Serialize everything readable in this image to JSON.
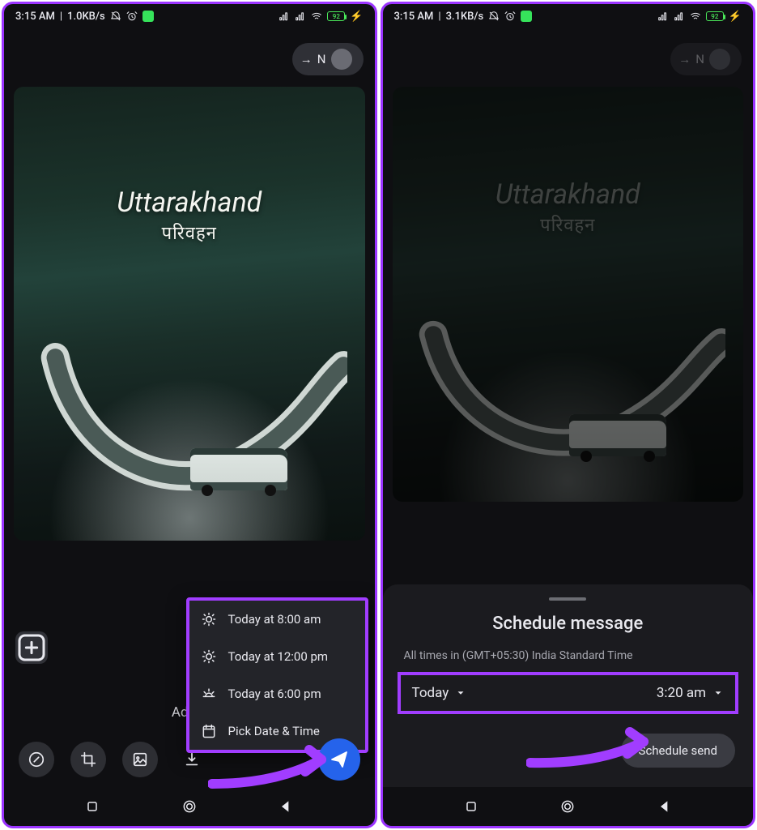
{
  "phone1": {
    "status": {
      "time": "3:15 AM",
      "net": "1.0KB/s",
      "battery": "92"
    },
    "recipient_prefix": "→",
    "recipient": "N",
    "overlay_title": "Uttarakhand",
    "overlay_sub": "परिवहन",
    "caption_placeholder": "Add a",
    "menu": {
      "item1": "Today at 8:00 am",
      "item2": "Today at 12:00 pm",
      "item3": "Today at 6:00 pm",
      "item4": "Pick Date & Time"
    }
  },
  "phone2": {
    "status": {
      "time": "3:15 AM",
      "net": "3.1KB/s",
      "battery": "92"
    },
    "recipient_prefix": "→",
    "recipient": "N",
    "overlay_title": "Uttarakhand",
    "overlay_sub": "परिवहन",
    "sheet": {
      "title": "Schedule message",
      "tz": "All times in (GMT+05:30) India Standard Time",
      "date": "Today",
      "time": "3:20 am",
      "button": "Schedule send"
    }
  },
  "colors": {
    "accent": "#a13dff",
    "send": "#2563eb"
  }
}
